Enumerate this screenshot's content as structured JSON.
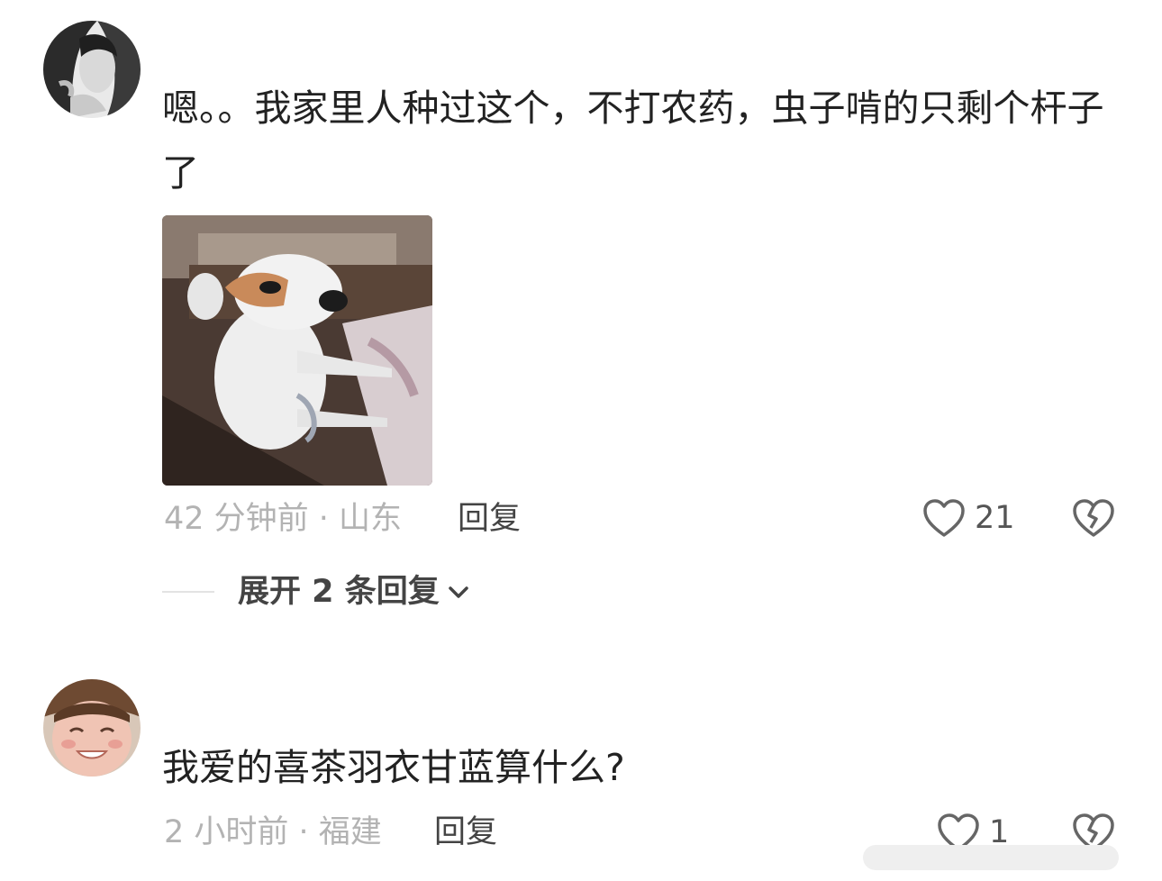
{
  "comments": [
    {
      "avatar_icon": "woman-portrait-avatar",
      "text": "嗯。。我家里人种过这个，不打农药，虫子啃的只剩个杆子了",
      "image_icon": "dog-meme-photo",
      "time_location": "42 分钟前 · 山东",
      "reply_label": "回复",
      "like_icon": "heart-icon",
      "like_count": "21",
      "dislike_icon": "broken-heart-icon",
      "expand_label": "展开 2 条回复",
      "expand_icon": "chevron-down-icon"
    },
    {
      "avatar_icon": "smiling-child-avatar",
      "text": "我爱的喜茶羽衣甘蓝算什么?",
      "time_location": "2 小时前 · 福建",
      "reply_label": "回复",
      "like_icon": "heart-icon",
      "like_count": "1",
      "dislike_icon": "broken-heart-icon"
    }
  ],
  "colors": {
    "text_primary": "#222222",
    "text_meta": "#b3b3b3",
    "text_action": "#444444",
    "icon": "#666666"
  }
}
